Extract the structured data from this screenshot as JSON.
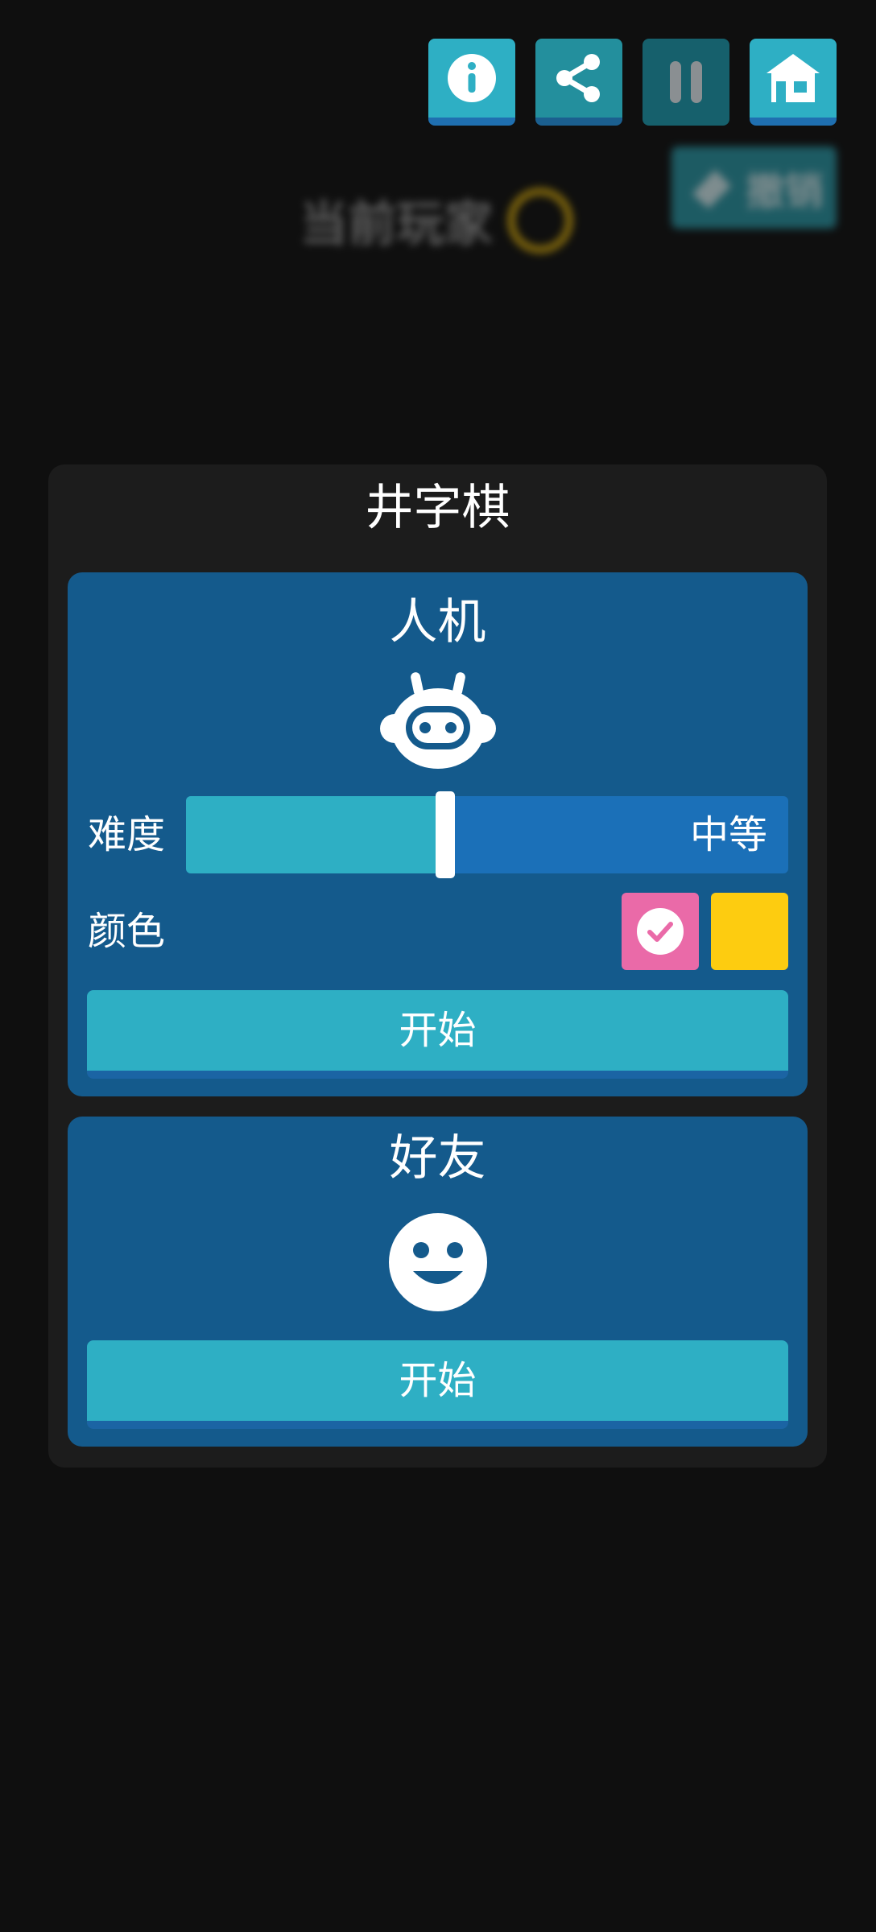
{
  "toolbar": {
    "icons": [
      "info-icon",
      "share-icon",
      "pause-icon",
      "home-icon"
    ]
  },
  "background": {
    "undo_label": "撤销",
    "current_player_label": "当前玩家",
    "current_player_color": "#d4a80c"
  },
  "modal": {
    "title": "井字棋",
    "vs_ai": {
      "title": "人机",
      "icon": "robot-icon",
      "difficulty_label": "难度",
      "difficulty_value": "中等",
      "difficulty_level": 0.43,
      "color_label": "颜色",
      "color_options": [
        "#ea6aa8",
        "#fdcc10"
      ],
      "selected_color": "#ea6aa8",
      "start_label": "开始"
    },
    "vs_friend": {
      "title": "好友",
      "icon": "smiley-icon",
      "start_label": "开始"
    }
  },
  "colors": {
    "background": "#0f0f0f",
    "modal": "#1c1c1c",
    "card": "#145a8c",
    "accent": "#2eafc4"
  }
}
